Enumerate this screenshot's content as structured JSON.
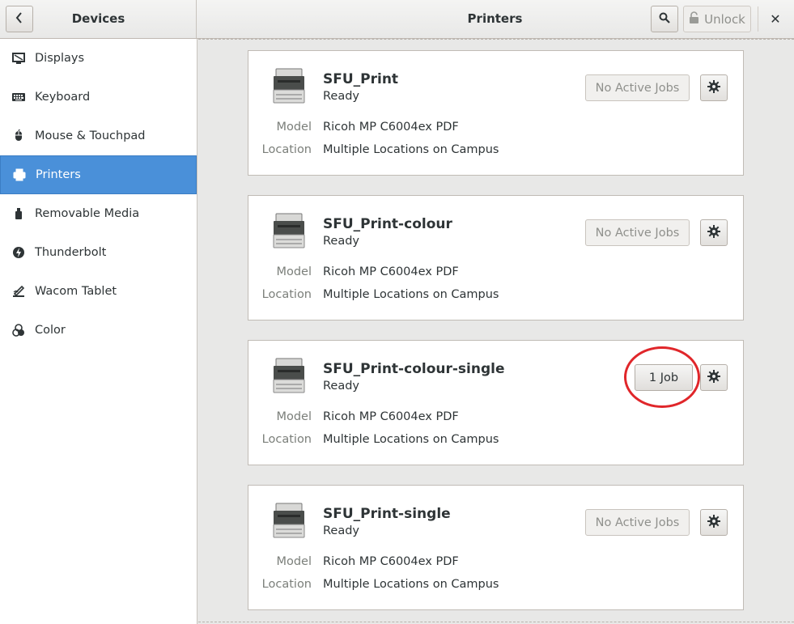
{
  "header": {
    "left_title": "Devices",
    "main_title": "Printers",
    "unlock_label": "Unlock",
    "back_icon": "chevron-left-icon",
    "search_icon": "search-icon",
    "close_icon": "close-icon",
    "close_glyph": "✕"
  },
  "sidebar": {
    "items": [
      {
        "label": "Displays",
        "icon": "display-icon"
      },
      {
        "label": "Keyboard",
        "icon": "keyboard-icon"
      },
      {
        "label": "Mouse & Touchpad",
        "icon": "mouse-icon"
      },
      {
        "label": "Printers",
        "icon": "printer-icon",
        "selected": true
      },
      {
        "label": "Removable Media",
        "icon": "usb-drive-icon"
      },
      {
        "label": "Thunderbolt",
        "icon": "thunderbolt-icon"
      },
      {
        "label": "Wacom Tablet",
        "icon": "tablet-icon"
      },
      {
        "label": "Color",
        "icon": "color-icon"
      }
    ]
  },
  "fields": {
    "model_label": "Model",
    "location_label": "Location"
  },
  "printers": [
    {
      "name": "SFU_Print",
      "state": "Ready",
      "model": "Ricoh MP C6004ex PDF",
      "location": "Multiple Locations on Campus",
      "jobs": "No Active Jobs"
    },
    {
      "name": "SFU_Print-colour",
      "state": "Ready",
      "model": "Ricoh MP C6004ex PDF",
      "location": "Multiple Locations on Campus",
      "jobs": "No Active Jobs"
    },
    {
      "name": "SFU_Print-colour-single",
      "state": "Ready",
      "model": "Ricoh MP C6004ex PDF",
      "location": "Multiple Locations on Campus",
      "jobs": "1 Job"
    },
    {
      "name": "SFU_Print-single",
      "state": "Ready",
      "model": "Ricoh MP C6004ex PDF",
      "location": "Multiple Locations on Campus",
      "jobs": "No Active Jobs"
    }
  ],
  "colors": {
    "selection": "#4a90d9",
    "highlight_ring": "#e0262a"
  }
}
